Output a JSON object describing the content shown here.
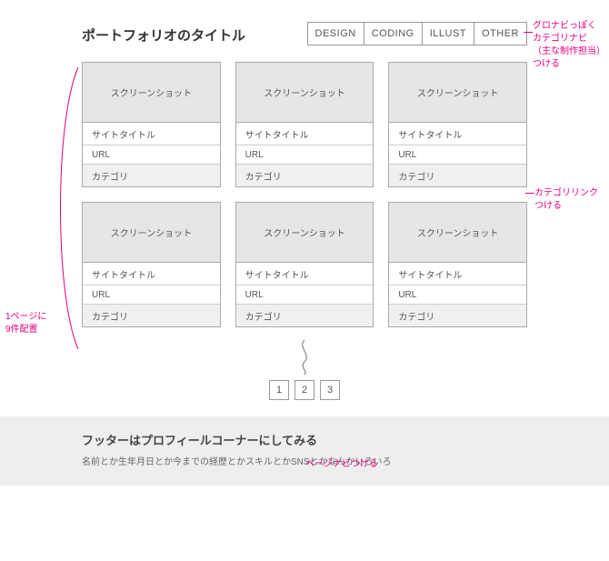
{
  "header": {
    "title": "ポートフォリオのタイトル",
    "nav": [
      "DESIGN",
      "CODING",
      "ILLUST",
      "OTHER"
    ]
  },
  "card": {
    "screenshot_label": "スクリーンショット",
    "site_title": "サイトタイトル",
    "url_label": "URL",
    "category_label": "カテゴリ"
  },
  "pagination": [
    "1",
    "2",
    "3"
  ],
  "footer": {
    "title": "フッターはプロフィールコーナーにしてみる",
    "sub": "名前とか生年月日とか今までの経歴とかスキルとかSNSとかなんかいろいろ"
  },
  "annotations": {
    "nav": "グロナビっぽく\nカテゴリナビ\n（主な制作担当）\nつける",
    "category": "カテゴリリンク\nつける",
    "pager": "ページナビつける",
    "grid": "1ページに\n9件配置"
  }
}
